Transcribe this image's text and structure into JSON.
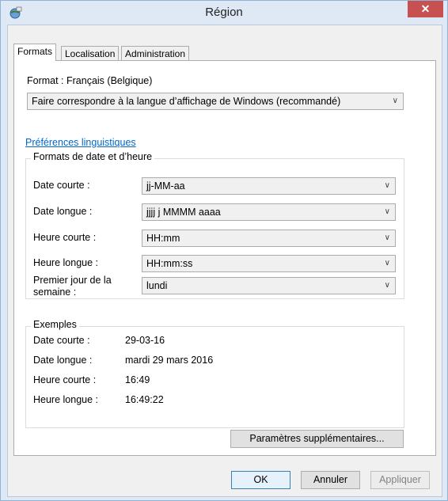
{
  "window": {
    "title": "Région",
    "close_glyph": "✕"
  },
  "tabs": [
    {
      "label": "Formats"
    },
    {
      "label": "Localisation"
    },
    {
      "label": "Administration"
    }
  ],
  "format": {
    "label": "Format : Français (Belgique)",
    "selected": "Faire correspondre à la langue d’affichage de Windows (recommandé)"
  },
  "link": {
    "label": "Préférences linguistiques"
  },
  "date_time_formats": {
    "title": "Formats de date et d’heure",
    "rows": [
      {
        "label": "Date courte :",
        "value": "jj-MM-aa"
      },
      {
        "label": "Date longue :",
        "value": "jjjj j MMMM aaaa"
      },
      {
        "label": "Heure courte :",
        "value": "HH:mm"
      },
      {
        "label": "Heure longue :",
        "value": "HH:mm:ss"
      },
      {
        "label": "Premier jour de la semaine :",
        "value": "lundi"
      }
    ]
  },
  "examples": {
    "title": "Exemples",
    "rows": [
      {
        "label": "Date courte :",
        "value": "29-03-16"
      },
      {
        "label": "Date longue :",
        "value": "mardi 29 mars 2016"
      },
      {
        "label": "Heure courte :",
        "value": "16:49"
      },
      {
        "label": "Heure longue :",
        "value": "16:49:22"
      }
    ]
  },
  "buttons": {
    "additional": "Paramètres supplémentaires...",
    "ok": "OK",
    "cancel": "Annuler",
    "apply": "Appliquer"
  },
  "icons": {
    "app": "region-globe-icon",
    "dropdown": "chevron-down-icon",
    "close": "close-icon"
  }
}
